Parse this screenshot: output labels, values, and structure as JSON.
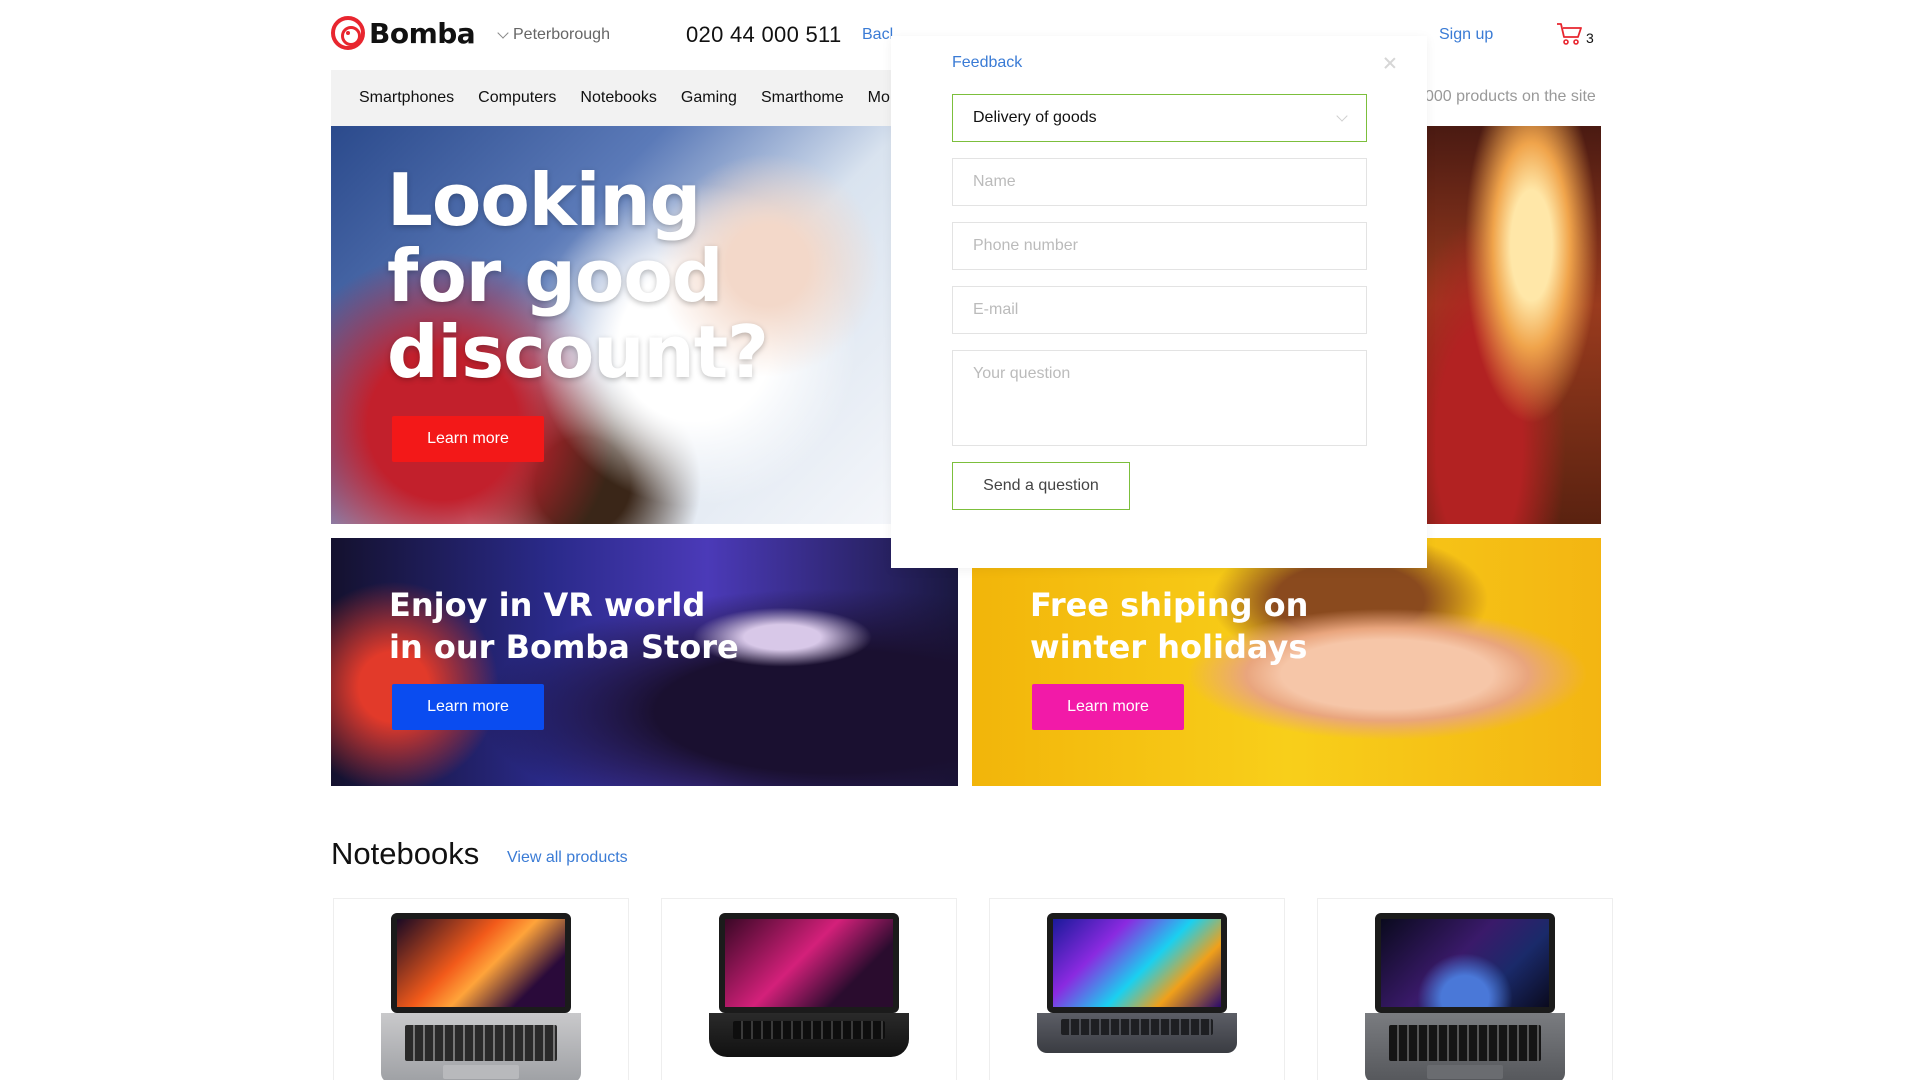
{
  "header": {
    "logo_text": "Bomba",
    "city": "Peterborough",
    "phone": "020 44 000 511",
    "back_call": "Bacl",
    "sign_up": "Sign up",
    "cart_count": "3"
  },
  "nav": {
    "items": [
      "Smartphones",
      "Computers",
      "Notebooks",
      "Gaming",
      "Smarthome",
      "Mo"
    ],
    "products_note": "000 products on the site"
  },
  "banners": {
    "hero": {
      "title": "Looking\nfor good\ndiscount?",
      "button": "Learn more",
      "button_color": "#f31818"
    },
    "vr": {
      "title": "Enjoy in VR world\nin our Bomba Store",
      "button": "Learn more",
      "button_color": "#0a4cf0"
    },
    "kid": {
      "title": "Free shiping on\nwinter holidays",
      "button": "Learn more",
      "button_color": "#f21aa8"
    }
  },
  "feedback": {
    "title": "Feedback",
    "topic": "Delivery of goods",
    "name_placeholder": "Name",
    "phone_placeholder": "Phone number",
    "email_placeholder": "E-mail",
    "question_placeholder": "Your question",
    "send_label": "Send a question",
    "accent_color": "#7cbf3c"
  },
  "notebooks": {
    "title": "Notebooks",
    "view_all": "View all products"
  },
  "colors": {
    "brand": "#e8262f",
    "link": "#3a7bd5"
  }
}
